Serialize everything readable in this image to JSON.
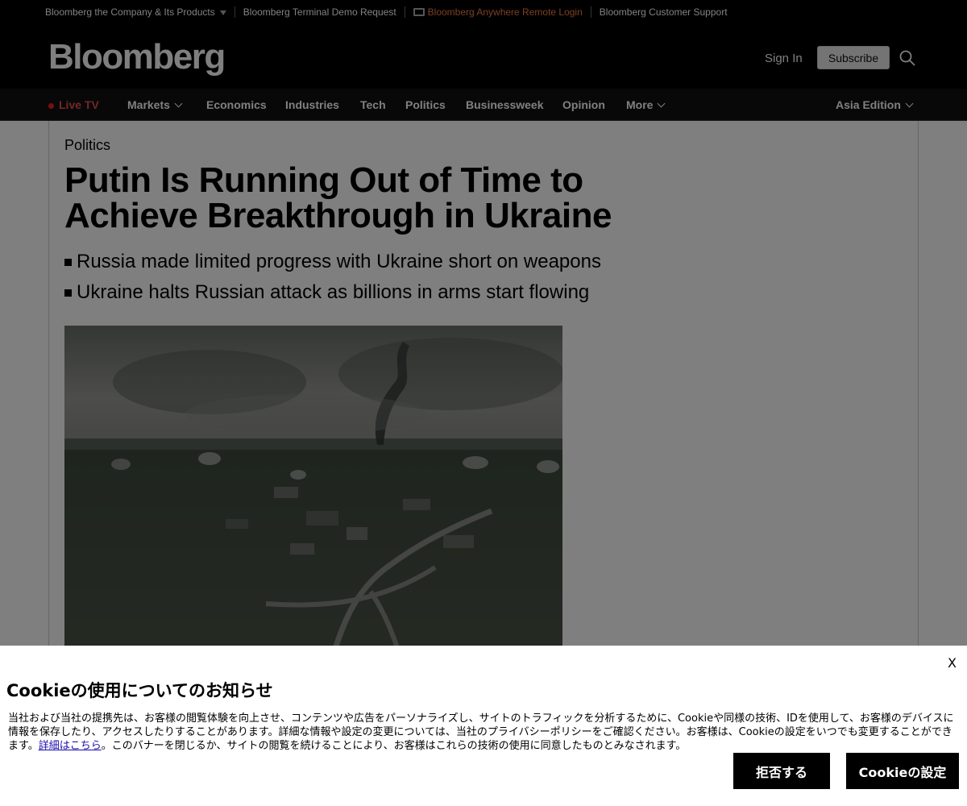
{
  "topbar": {
    "company_link": "Bloomberg the Company & Its Products",
    "terminal_link": "Bloomberg Terminal Demo Request",
    "anywhere_link": "Bloomberg Anywhere Remote Login",
    "support_link": "Bloomberg Customer Support"
  },
  "header": {
    "logo": "Bloomberg",
    "signin": "Sign In",
    "subscribe": "Subscribe"
  },
  "nav": {
    "live_tv": "Live TV",
    "markets": "Markets",
    "economics": "Economics",
    "industries": "Industries",
    "tech": "Tech",
    "politics": "Politics",
    "businessweek": "Businessweek",
    "opinion": "Opinion",
    "more": "More",
    "edition": "Asia Edition"
  },
  "article": {
    "section": "Politics",
    "headline": "Putin Is Running Out of Time to Achieve Breakthrough in Ukraine",
    "summary": [
      "Russia made limited progress with Ukraine short on weapons",
      "Ukraine halts Russian attack as billions in arms start flowing"
    ]
  },
  "cookie": {
    "close": "X",
    "title": "Cookieの使用についてのお知らせ",
    "body_part1": "当社および当社の提携先は、お客様の閲覧体験を向上させ、コンテンツや広告をパーソナライズし、サイトのトラフィックを分析するために、Cookieや同様の技術、IDを使用して、お客様のデバイスに情報を保存したり、アクセスしたりすることがあります。詳細な情報や設定の変更については、当社のプライバシーポリシーをご確認ください。お客様は、Cookieの設定をいつでも変更することができます。",
    "body_link": "詳細はこちら",
    "body_part2": "。このバナーを閉じるか、サイトの閲覧を続けることにより、お客様はこれらの技術の使用に同意したものとみなされます。",
    "reject": "拒否する",
    "settings": "Cookieの設定"
  },
  "colors": {
    "anywhere_accent": "#f97e46",
    "live_accent": "#e94e4e",
    "link": "#1a0dab"
  }
}
